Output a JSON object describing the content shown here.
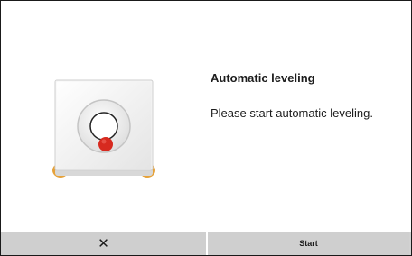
{
  "dialog": {
    "title": "Automatic leveling",
    "message": "Please start automatic leveling."
  },
  "illustration": {
    "name": "level-sensor-illustration",
    "accent_color": "#d72a1f",
    "foot_color": "#e6a23a"
  },
  "buttons": {
    "cancel_icon": "close-icon",
    "cancel_glyph": "✕",
    "start_label": "Start"
  },
  "colors": {
    "button_bar": "#cfcfcf",
    "divider": "#ffffff",
    "text": "#1c1c1c"
  }
}
